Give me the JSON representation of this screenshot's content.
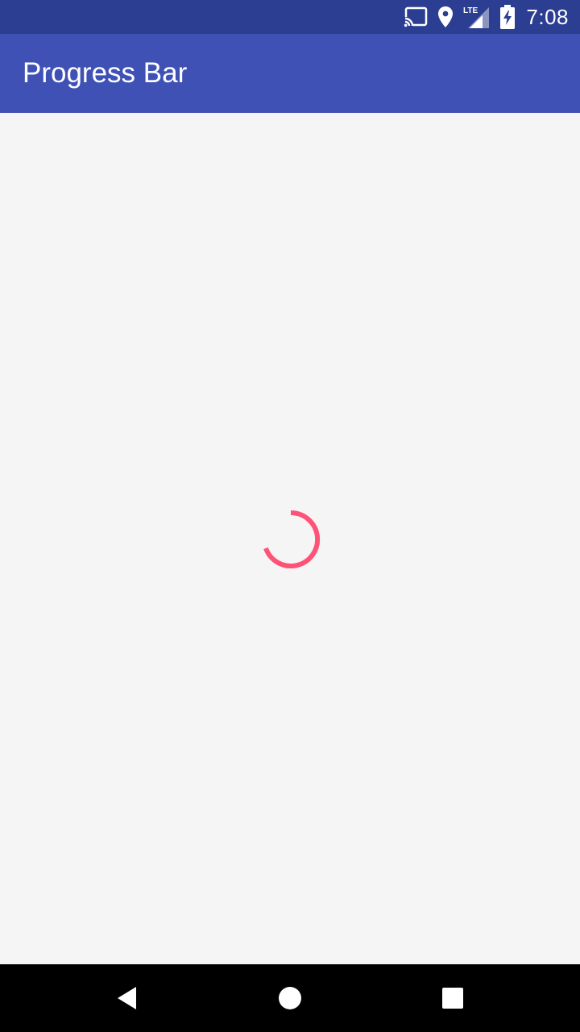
{
  "status_bar": {
    "time": "7:08",
    "network_label": "LTE",
    "icons": [
      "cast-icon",
      "location-icon",
      "signal-icon",
      "battery-charging-icon"
    ]
  },
  "app_bar": {
    "title": "Progress Bar"
  },
  "progress": {
    "type": "indeterminate-circular",
    "color": "#ff5277"
  },
  "nav_bar": {
    "icons": [
      "back-icon",
      "home-icon",
      "recents-icon"
    ]
  },
  "colors": {
    "status_bar": "#2c3e91",
    "app_bar": "#3f51b5",
    "background": "#f5f5f5",
    "accent": "#ff5277"
  }
}
